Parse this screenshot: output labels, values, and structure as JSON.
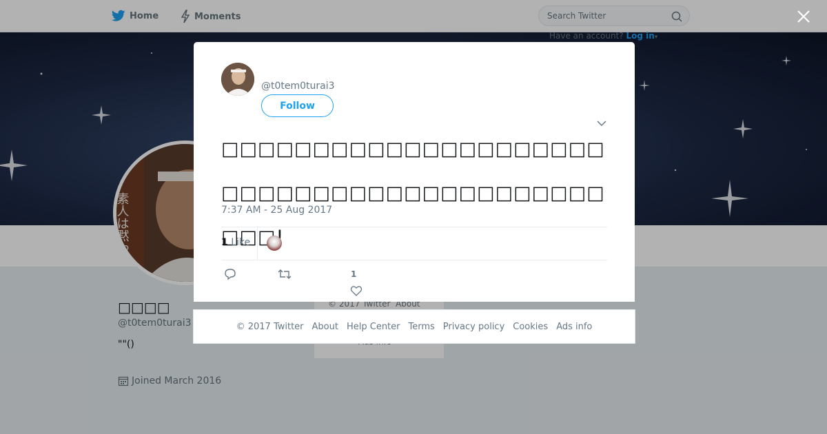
{
  "nav": {
    "home_label": "Home",
    "moments_label": "Moments",
    "search_placeholder": "Search Twitter",
    "account_prompt": "Have an account?",
    "login_label": "Log in"
  },
  "profile": {
    "name": "□□□□",
    "handle": "@t0tem0turai3",
    "bio": "\"\"()",
    "joined": "Joined March 2016",
    "avatar_text": "素人は黙っとれ"
  },
  "background_footer": {
    "copyright": "© 2017 Twitter",
    "about": "About",
    "ads_info": "Ads info"
  },
  "tweet": {
    "handle": "@t0tem0turai3",
    "follow_label": "Follow",
    "text": "□□□□□□□□□□□□□□□□□□□□□□□□□□□□□□□□□□□□□□□□□□□□□!",
    "time": "7:37 AM - 25 Aug 2017",
    "like_count": "1",
    "like_label": "Like",
    "like_action_count": "1"
  },
  "footer": {
    "links": [
      "© 2017 Twitter",
      "About",
      "Help Center",
      "Terms",
      "Privacy policy",
      "Cookies",
      "Ads info"
    ]
  },
  "colors": {
    "accent": "#1da1f2",
    "muted": "#657786",
    "text": "#14171a"
  },
  "icons": {
    "home": "twitter-bird-icon",
    "moments": "lightning-icon",
    "search": "search-icon",
    "close": "close-icon",
    "caret": "chevron-down-icon",
    "reply": "reply-icon",
    "retweet": "retweet-icon",
    "like": "heart-icon",
    "calendar": "calendar-icon"
  }
}
